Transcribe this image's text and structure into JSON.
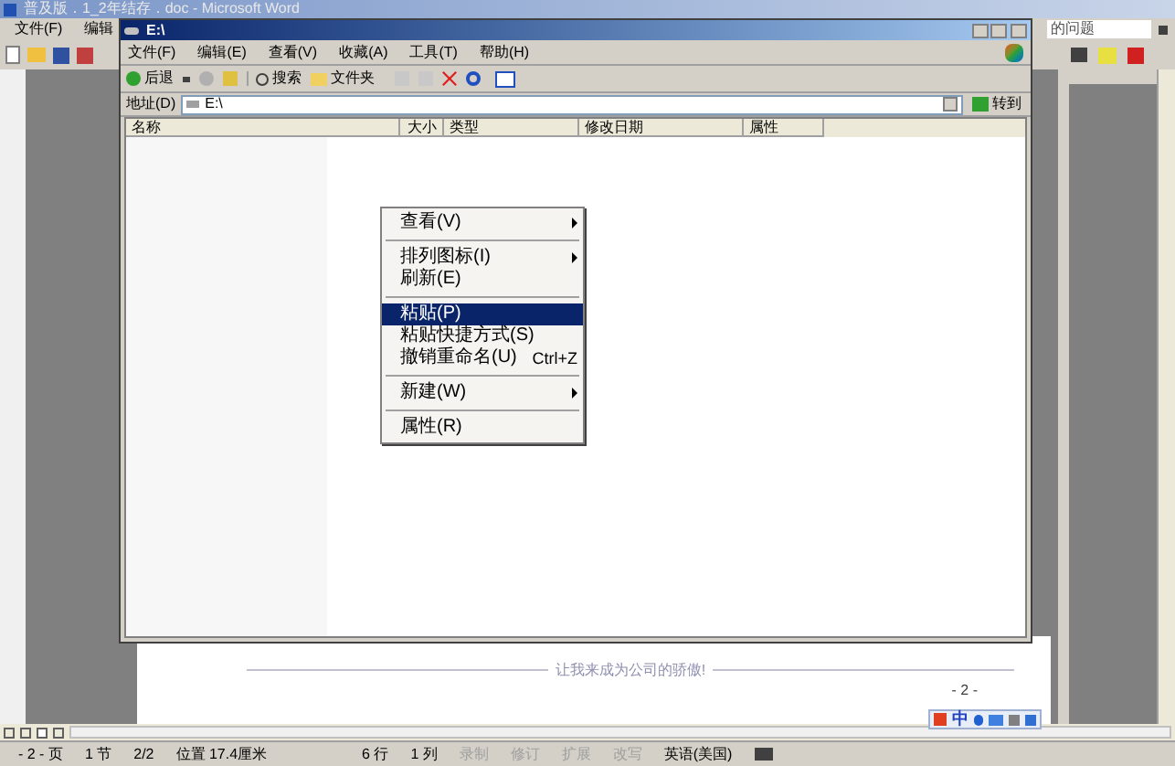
{
  "word_window": {
    "title": "普及版．1_2年结存．doc - Microsoft Word",
    "menu": [
      "文件(F)",
      "编辑"
    ],
    "help_box": {
      "placeholder": "的问题"
    },
    "document_text": "让我来成为公司的骄傲!",
    "page_number": "- 2 -"
  },
  "explorer": {
    "title": "E:\\",
    "menu": [
      "文件(F)",
      "编辑(E)",
      "查看(V)",
      "收藏(A)",
      "工具(T)",
      "帮助(H)"
    ],
    "toolbar": {
      "back": "后退",
      "search": "搜索",
      "folders": "文件夹"
    },
    "address": {
      "label": "地址(D)",
      "value": "E:\\",
      "go": "转到"
    },
    "columns": [
      "名称",
      "大小",
      "类型",
      "修改日期",
      "属性"
    ]
  },
  "context_menu": [
    {
      "kind": "item",
      "label": "查看(V)",
      "submenu": true,
      "selected": false
    },
    {
      "kind": "separator"
    },
    {
      "kind": "item",
      "label": "排列图标(I)",
      "submenu": true,
      "selected": false
    },
    {
      "kind": "item",
      "label": "刷新(E)",
      "submenu": false,
      "selected": false
    },
    {
      "kind": "separator"
    },
    {
      "kind": "item",
      "label": "粘贴(P)",
      "submenu": false,
      "selected": true
    },
    {
      "kind": "item",
      "label": "粘贴快捷方式(S)",
      "submenu": false,
      "selected": false
    },
    {
      "kind": "item",
      "label": "撤销重命名(U)",
      "shortcut": "Ctrl+Z",
      "submenu": false,
      "selected": false
    },
    {
      "kind": "separator"
    },
    {
      "kind": "item",
      "label": "新建(W)",
      "submenu": true,
      "selected": false
    },
    {
      "kind": "separator"
    },
    {
      "kind": "item",
      "label": "属性(R)",
      "submenu": false,
      "selected": false
    }
  ],
  "status_bar": [
    {
      "text": "- 2 - 页",
      "enabled": true
    },
    {
      "text": "1 节",
      "enabled": true
    },
    {
      "text": "2/2",
      "enabled": true
    },
    {
      "text": "位置 17.4厘米",
      "enabled": true
    },
    {
      "text": "6 行",
      "enabled": true
    },
    {
      "text": "1 列",
      "enabled": true
    },
    {
      "text": "录制",
      "enabled": false
    },
    {
      "text": "修订",
      "enabled": false
    },
    {
      "text": "扩展",
      "enabled": false
    },
    {
      "text": "改写",
      "enabled": false
    },
    {
      "text": "英语(美国)",
      "enabled": true
    }
  ],
  "ime_bar": {
    "mode": "中"
  }
}
